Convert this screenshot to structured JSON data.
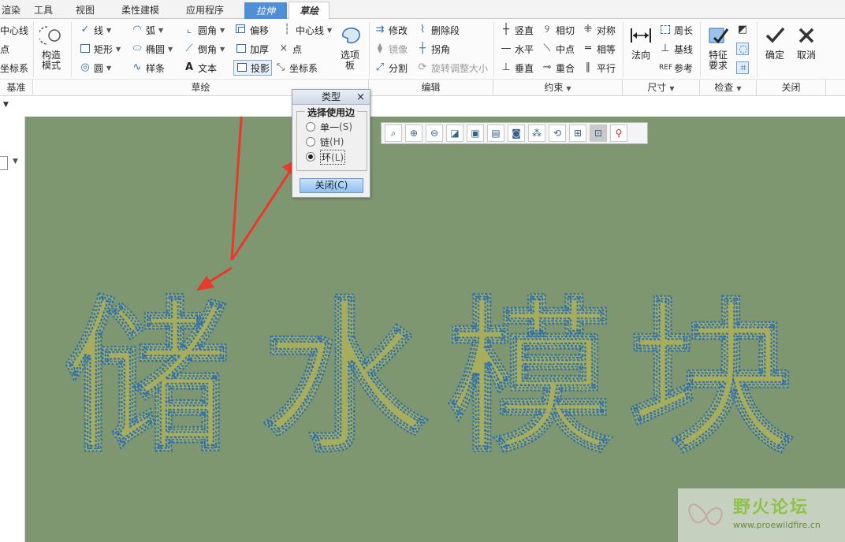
{
  "tabs": [
    {
      "label": "渲染"
    },
    {
      "label": "工具"
    },
    {
      "label": "视图"
    },
    {
      "label": "柔性建模"
    },
    {
      "label": "应用程序"
    },
    {
      "label": "拉伸"
    },
    {
      "label": "草绘"
    }
  ],
  "ribbon": {
    "datum": {
      "items": [
        "中心线",
        "点",
        "坐标系"
      ],
      "group": "基准"
    },
    "construct_mode": "构造\n模式",
    "sketch": {
      "line": "线",
      "rect": "矩形",
      "circle": "圆",
      "arc": "弧",
      "ellipse": "椭圆",
      "spline": "样条",
      "fillet": "圆角",
      "chamfer": "倒角",
      "text": "文本",
      "offset": "偏移",
      "thicken": "加厚",
      "project": "投影",
      "centerline": "中心线",
      "point": "点",
      "coordsys": "坐标系",
      "palette": "选项\n板",
      "group": "草绘"
    },
    "edit": {
      "modify": "修改",
      "mirror": "镜像",
      "divide": "分割",
      "delete_segment": "删除段",
      "corner": "拐角",
      "rotate_resize": "旋转调整大小",
      "group": "编辑"
    },
    "constrain": {
      "vertical": "竖直",
      "horizontal": "水平",
      "perpendicular": "垂直",
      "tangent": "相切",
      "midpoint": "中点",
      "coincident": "重合",
      "symmetric": "对称",
      "equal": "相等",
      "parallel": "平行",
      "group": "约束"
    },
    "dimension": {
      "normal": "法向",
      "perimeter": "周长",
      "baseline": "基线",
      "reference": "参考",
      "group": "尺寸"
    },
    "inspect": {
      "feature_req": "特征\n要求",
      "group": "检查"
    },
    "close": {
      "ok": "确定",
      "cancel": "取消",
      "group": "关闭"
    }
  },
  "dialog": {
    "title": "类型",
    "close_icon": "×",
    "legend": "选择使用边",
    "options": [
      {
        "label": "单一",
        "key": "(S)",
        "selected": false
      },
      {
        "label": "链",
        "key": "(H)",
        "selected": false
      },
      {
        "label": "环",
        "key": "(L)",
        "selected": true
      }
    ],
    "close_button": "关闭(C)"
  },
  "canvas": {
    "background": "#7f9770",
    "sketch_text": [
      "储",
      "水",
      "模",
      "块"
    ],
    "sketch_fill": "#b5b457",
    "outline_color": "#2c6fb0",
    "annotation_color": "#e8392b"
  },
  "watermark": {
    "name": "野火论坛",
    "url": "www.proewildfire.cn"
  }
}
